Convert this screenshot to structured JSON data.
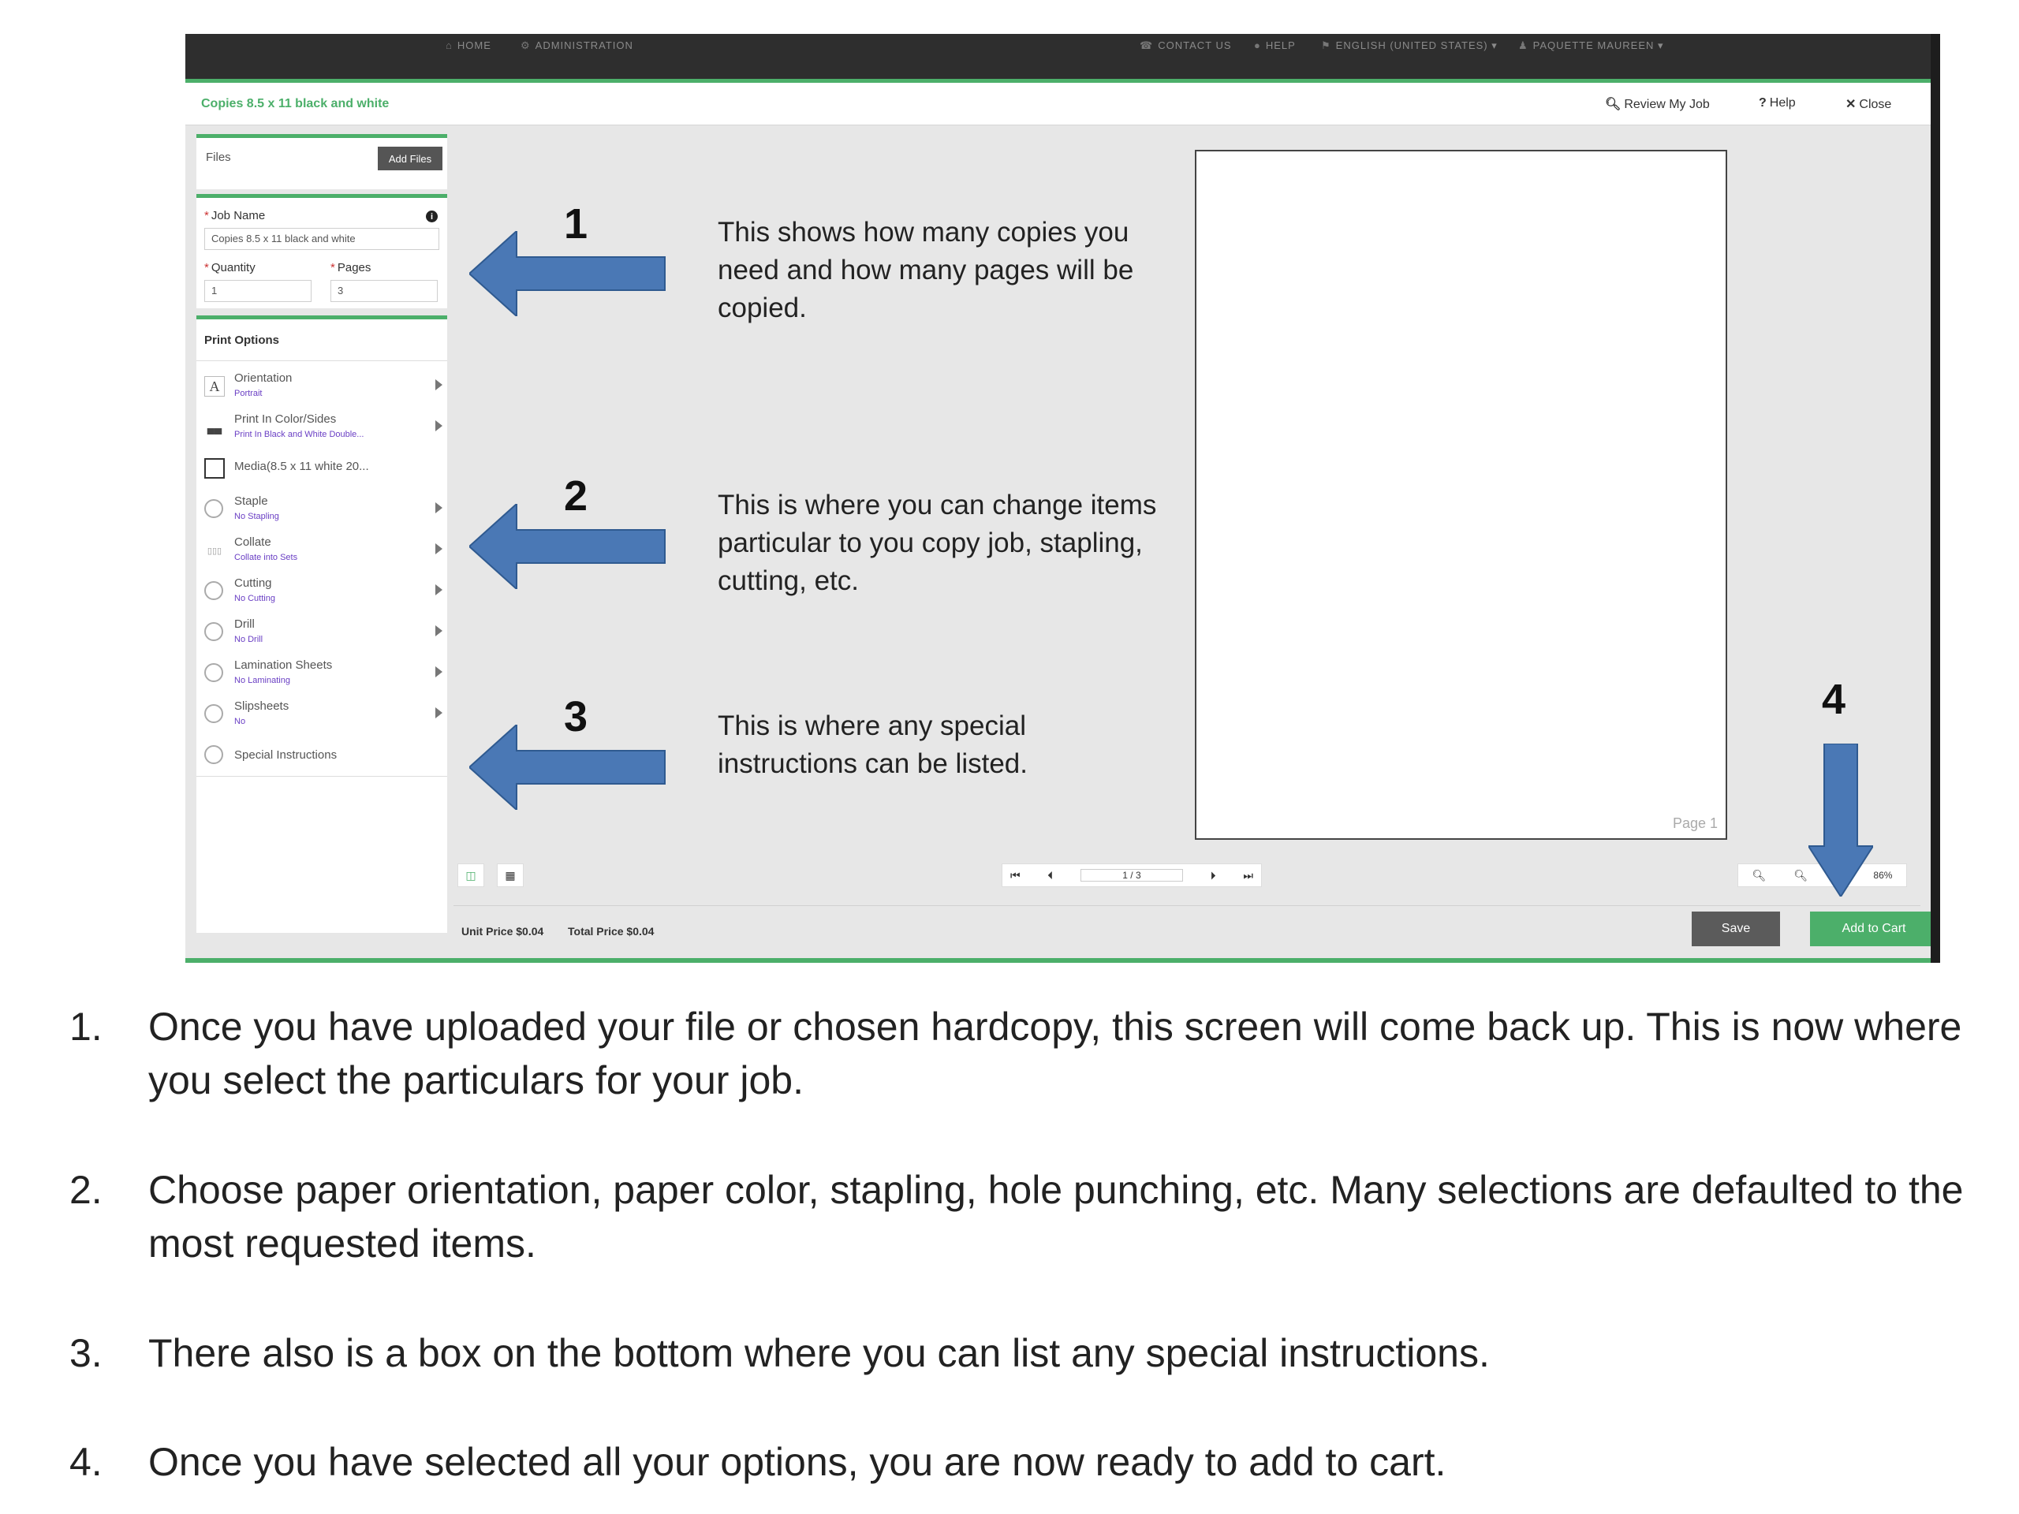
{
  "topnav": {
    "items": [
      "HOME",
      "ADMINISTRATION",
      "CONTACT US",
      "HELP",
      "ENGLISH (UNITED STATES)",
      "PAQUETTE MAUREEN"
    ]
  },
  "jobbar": {
    "title": "Copies 8.5 x 11 black and white",
    "review": "Review My Job",
    "help": "Help",
    "close": "Close"
  },
  "files": {
    "label": "Files",
    "add_button": "Add Files"
  },
  "job": {
    "name_label": "Job Name",
    "name_value": "Copies 8.5 x 11 black and white",
    "quantity_label": "Quantity",
    "quantity_value": "1",
    "pages_label": "Pages",
    "pages_value": "3"
  },
  "print_options": {
    "heading": "Print Options",
    "items": [
      {
        "name": "Orientation",
        "value": "Portrait",
        "icon": "letter-a-icon"
      },
      {
        "name": "Print In Color/Sides",
        "value": "Print In Black and White Double...",
        "icon": "duplex-icon"
      },
      {
        "name": "Media(8.5 x 11 white 20...",
        "value": "",
        "icon": "media-checkbox-icon"
      },
      {
        "name": "Staple",
        "value": "No Stapling",
        "icon": "radio-icon"
      },
      {
        "name": "Collate",
        "value": "Collate into Sets",
        "icon": "collate-icon"
      },
      {
        "name": "Cutting",
        "value": "No Cutting",
        "icon": "radio-icon"
      },
      {
        "name": "Drill",
        "value": "No Drill",
        "icon": "radio-icon"
      },
      {
        "name": "Lamination Sheets",
        "value": "No Laminating",
        "icon": "radio-icon"
      },
      {
        "name": "Slipsheets",
        "value": "No",
        "icon": "radio-icon"
      },
      {
        "name": "Special Instructions",
        "value": "",
        "icon": "radio-icon"
      }
    ]
  },
  "preview": {
    "page_label": "Page 1",
    "pager": "1 / 3",
    "zoom": "86%"
  },
  "pricing": {
    "unit": "Unit Price $0.04",
    "total": "Total Price $0.04"
  },
  "actions": {
    "save": "Save",
    "add_to_cart": "Add to Cart"
  },
  "callouts": [
    {
      "num": "1",
      "text": "This shows how many copies you need and how many pages will be copied."
    },
    {
      "num": "2",
      "text": "This is where you can change items particular to you copy job, stapling, cutting, etc."
    },
    {
      "num": "3",
      "text": "This is where any special instructions can be listed."
    },
    {
      "num": "4",
      "text": ""
    }
  ],
  "steps": [
    {
      "num": "1.",
      "text": "Once you have uploaded your file or chosen hardcopy, this screen will come back up. This is now where you select the particulars for your job."
    },
    {
      "num": "2.",
      "text": "Choose paper orientation, paper color, stapling, hole punching, etc. Many selections are defaulted to the most requested items."
    },
    {
      "num": "3.",
      "text": "There also is a box on the bottom where you can list any special instructions."
    },
    {
      "num": "4.",
      "text": "Once you have selected all your options, you are now ready to add to cart."
    }
  ],
  "colors": {
    "accent": "#4caf6a",
    "arrow": "#4a78b5",
    "link_value": "#6a3fc4"
  }
}
